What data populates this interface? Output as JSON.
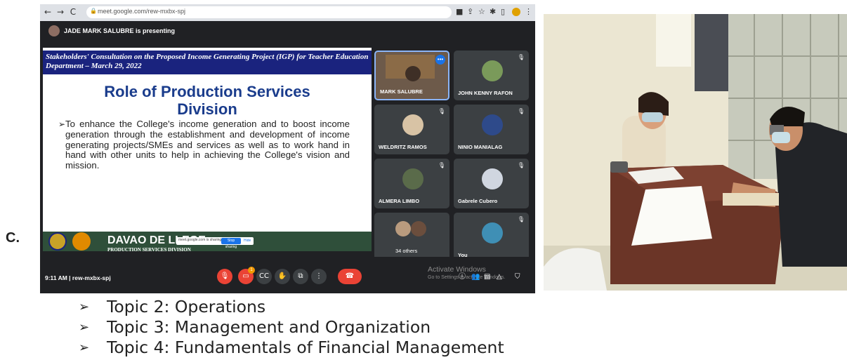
{
  "label_c": "C.",
  "browser": {
    "url": "meet.google.com/rew-mxbx-spj",
    "nav_back": "←",
    "nav_forward": "→",
    "nav_reload": "C"
  },
  "meet": {
    "presenting_banner": "JADE MARK SALUBRE is presenting",
    "slide": {
      "header": "Stakeholders' Consultation on the Proposed Income Generating Project (IGP) for Teacher Education Department – March 29, 2022",
      "title_line1": "Role of Production Services",
      "title_line2": "Division",
      "bullet": "To enhance the College's income generation and to boost income generation through the establishment and development of income generating projects/SMEs and services as well as to work hand in hand with other units to help in achieving the College's vision and mission.",
      "footer_college": "DAVAO DE   LLEGE",
      "footer_division": "PRODUCTION SERVICES DIVISION",
      "share_popup_text": "meet.google.com is sharing your screen",
      "share_stop": "Stop sharing",
      "share_hide": "Hide"
    },
    "participants": [
      {
        "name": "MARK SALUBRE",
        "muted": false
      },
      {
        "name": "JOHN KENNY RAFON",
        "muted": true
      },
      {
        "name": "WELDRITZ RAMOS",
        "muted": true
      },
      {
        "name": "NINIO MANIALAG",
        "muted": true
      },
      {
        "name": "ALMERA LIMBO",
        "muted": true
      },
      {
        "name": "Gabrele Cubero",
        "muted": true
      },
      {
        "name": "34 others",
        "muted": false
      },
      {
        "name": "You",
        "muted": true
      }
    ],
    "meeting_time": "9:11 AM",
    "meeting_code": "rew-mxbx-spj",
    "notification_count": "1",
    "activate_line1": "Activate Windows",
    "activate_line2": "Go to Settings to activate Windows."
  },
  "topics": [
    "Topic 2: Operations",
    "Topic 3: Management and Organization",
    "Topic 4: Fundamentals of Financial Management"
  ],
  "colors": {
    "meet_bg": "#202124",
    "tile_bg": "#3c4043",
    "slide_header": "#1a237e",
    "slide_title": "#1a3c8c",
    "end_call": "#ea4335"
  }
}
